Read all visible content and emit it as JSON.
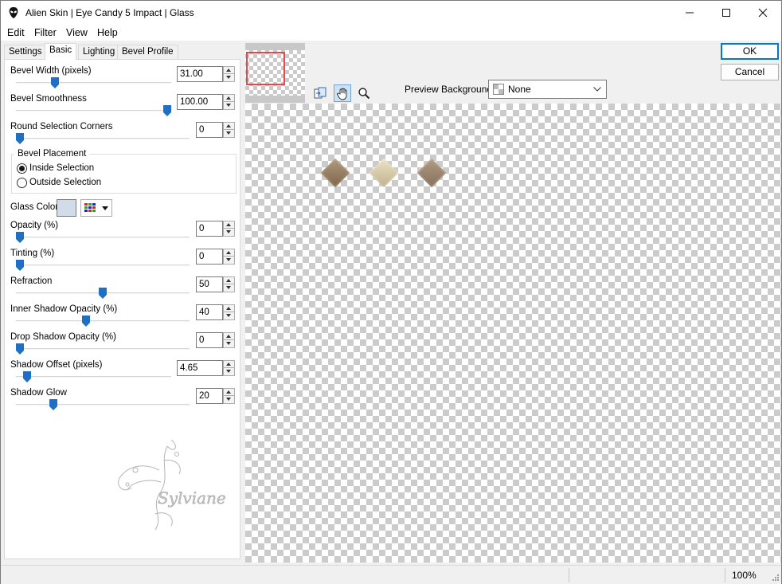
{
  "window": {
    "title": "Alien Skin | Eye Candy 5 Impact | Glass"
  },
  "menu": [
    "Edit",
    "Filter",
    "View",
    "Help"
  ],
  "tabs": [
    "Settings",
    "Basic",
    "Lighting",
    "Bevel Profile"
  ],
  "active_tab": "Basic",
  "controls": {
    "bevel_width": {
      "label": "Bevel Width (pixels)",
      "value": "31.00",
      "slider_fraction": 0.24
    },
    "bevel_smoothness": {
      "label": "Bevel Smoothness",
      "value": "100.00",
      "slider_fraction": 1.0
    },
    "round_corners": {
      "label": "Round Selection Corners",
      "value": "0",
      "slider_fraction": 0.0
    },
    "bevel_placement": {
      "title": "Bevel Placement",
      "inside": "Inside Selection",
      "outside": "Outside Selection",
      "selected": "inside"
    },
    "glass_color": {
      "label": "Glass Color",
      "color": "#d2dce8"
    },
    "opacity": {
      "label": "Opacity (%)",
      "value": "0",
      "slider_fraction": 0.0
    },
    "tinting": {
      "label": "Tinting (%)",
      "value": "0",
      "slider_fraction": 0.0
    },
    "refraction": {
      "label": "Refraction",
      "value": "50",
      "slider_fraction": 0.5
    },
    "inner_shadow": {
      "label": "Inner Shadow Opacity (%)",
      "value": "40",
      "slider_fraction": 0.4
    },
    "drop_shadow": {
      "label": "Drop Shadow Opacity (%)",
      "value": "0",
      "slider_fraction": 0.0
    },
    "shadow_offset": {
      "label": "Shadow Offset (pixels)",
      "value": "4.65",
      "slider_fraction": 0.05
    },
    "shadow_glow": {
      "label": "Shadow Glow",
      "value": "20",
      "slider_fraction": 0.2
    }
  },
  "watermark": "Sylviane",
  "buttons": {
    "ok": "OK",
    "cancel": "Cancel"
  },
  "preview": {
    "background_label": "Preview Background:",
    "background_value": "None"
  },
  "status": {
    "zoom": "100%"
  },
  "colors": {
    "accent": "#0078d4",
    "slider_thumb": "#1f6fc5",
    "nav_rect": "#e8474b"
  }
}
